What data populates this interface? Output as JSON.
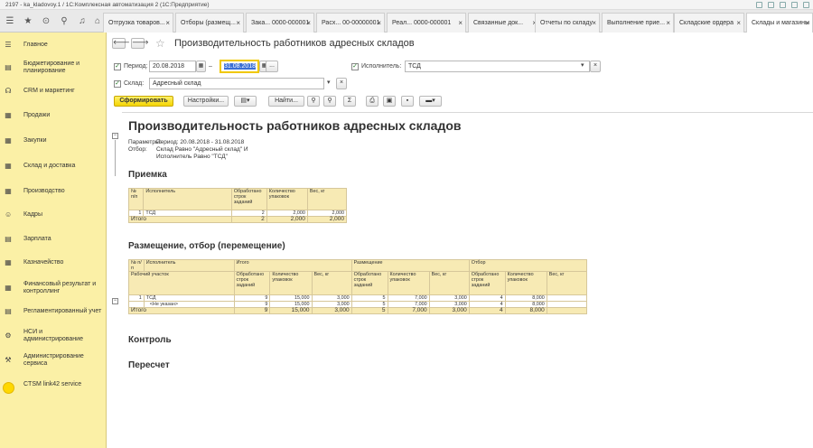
{
  "window": {
    "title": "2197 - ka_kladovoy.1 / 1С:Комплексная автоматизация 2  (1С:Предприятие)"
  },
  "tabs": [
    "Отгрузка товаров...",
    "Отборы (размещ...",
    "Зака... 0000-000001",
    "Расх... 00-00000001",
    "Реал... 0000-000001",
    "Связанные док...",
    "Отчеты по складу",
    "Выполнение прие...",
    "Складские ордера",
    "Склады и магазины"
  ],
  "sidebar": {
    "items": [
      {
        "label": "Главное",
        "icon": "menu-icon"
      },
      {
        "label": "Бюджетирование и планирование",
        "icon": "budget-icon"
      },
      {
        "label": "CRM и маркетинг",
        "icon": "crm-icon"
      },
      {
        "label": "Продажи",
        "icon": "sales-icon"
      },
      {
        "label": "Закупки",
        "icon": "purchase-icon"
      },
      {
        "label": "Склад и доставка",
        "icon": "warehouse-icon"
      },
      {
        "label": "Производство",
        "icon": "production-icon"
      },
      {
        "label": "Кадры",
        "icon": "staff-icon"
      },
      {
        "label": "Зарплата",
        "icon": "salary-icon"
      },
      {
        "label": "Казначейство",
        "icon": "treasury-icon"
      },
      {
        "label": "Финансовый результат и контроллинг",
        "icon": "finance-icon"
      },
      {
        "label": "Регламентированный учет",
        "icon": "accounting-icon"
      },
      {
        "label": "НСИ и администрирование",
        "icon": "nsi-icon"
      },
      {
        "label": "Администрирование сервиса",
        "icon": "admin-icon"
      },
      {
        "label": "CTSM link42 service",
        "icon": "ctsm-icon"
      }
    ]
  },
  "form": {
    "title": "Производительность работников адресных складов",
    "period_label": "Период:",
    "date_from": "20.08.2018",
    "date_sep": "–",
    "date_to": "31.08.2018",
    "dots": "...",
    "executor_label": "Исполнитель:",
    "executor_value": "ТСД",
    "warehouse_label": "Склад:",
    "warehouse_value": "Адресный склад",
    "generate_button": "Сформировать",
    "settings_button": "Настройки...",
    "find_button": "Найти...",
    "sum_symbol": "Σ"
  },
  "report": {
    "title": "Производительность работников адресных складов",
    "params_label": "Параметры:",
    "params_value": "Период: 20.08.2018 - 31.08.2018",
    "filter_label": "Отбор:",
    "filter_line1": "Склад Равно \"Адресный склад\" И",
    "filter_line2": "Исполнитель Равно \"ТСД\"",
    "section1": {
      "title": "Приемка",
      "headers": {
        "num": "№ п/п",
        "executor": "Исполнитель",
        "lines": "Обработано строк заданий",
        "packs": "Количество упаковок",
        "weight": "Вес, кг"
      },
      "rows": [
        {
          "num": "1",
          "executor": "ТСД",
          "lines": "2",
          "packs": "2,000",
          "weight": "2,000"
        }
      ],
      "total": {
        "label": "Итого",
        "lines": "2",
        "packs": "2,000",
        "weight": "2,000"
      }
    },
    "section2": {
      "title": "Размещение, отбор (перемещение)",
      "headers": {
        "num": "№ п/п",
        "executor": "Исполнитель",
        "total": "Итого",
        "placement": "Размещение",
        "selection": "Отбор",
        "work_area": "Рабочий участок",
        "lines": "Обработано строк заданий",
        "packs": "Количество упаковок",
        "weight": "Вес, кг"
      },
      "rows": [
        {
          "num": "1",
          "name": "ТСД",
          "t_lines": "9",
          "t_packs": "15,000",
          "t_weight": "3,000",
          "p_lines": "5",
          "p_packs": "7,000",
          "p_weight": "3,000",
          "s_lines": "4",
          "s_packs": "8,000",
          "s_weight": ""
        },
        {
          "num": "",
          "name": "<Не указан>",
          "t_lines": "9",
          "t_packs": "15,000",
          "t_weight": "3,000",
          "p_lines": "5",
          "p_packs": "7,000",
          "p_weight": "3,000",
          "s_lines": "4",
          "s_packs": "8,000",
          "s_weight": ""
        }
      ],
      "total": {
        "label": "Итого",
        "t_lines": "9",
        "t_packs": "15,000",
        "t_weight": "3,000",
        "p_lines": "5",
        "p_packs": "7,000",
        "p_weight": "3,000",
        "s_lines": "4",
        "s_packs": "8,000",
        "s_weight": ""
      }
    },
    "section3_title": "Контроль",
    "section4_title": "Пересчет"
  },
  "colors": {
    "sidebar": "#fbf0a6",
    "accent": "#f5d500",
    "table_header": "#f7eab4"
  }
}
